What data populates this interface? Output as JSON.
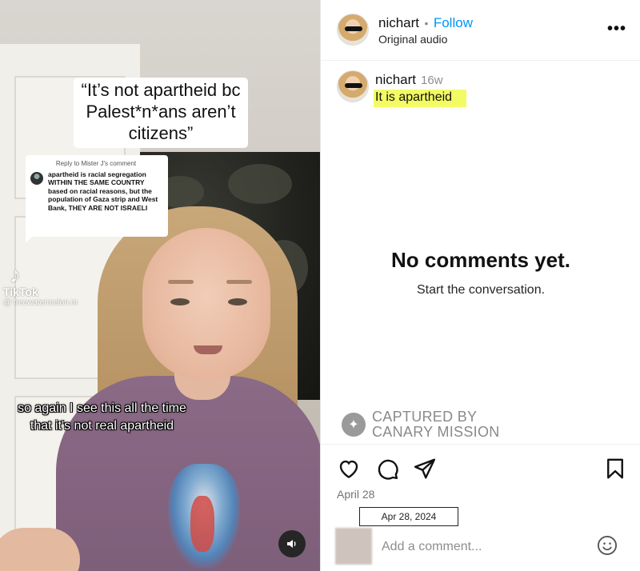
{
  "video": {
    "caption_overlay": "“It’s not apartheid bc Palest*n*ans aren’t citizens”",
    "reply_card": {
      "header": "Reply to Mister J's comment",
      "text": "apartheid is racial segregation WITHIN THE SAME COUNTRY based on racial reasons, but the population of Gaza strip and West Bank, THEY ARE NOT ISRAELI"
    },
    "tiktok": {
      "brand": "TikTok",
      "handle": "@ freewatermelon.m"
    },
    "subtitle": "so again I see this all the time that it's not real apartheid",
    "sound_icon": "speaker-icon"
  },
  "post_header": {
    "username": "nichart",
    "separator": "•",
    "follow_label": "Follow",
    "audio_label": "Original audio",
    "more_label": "•••"
  },
  "comment": {
    "username": "nichart",
    "age": "16w",
    "text": "It is apartheid",
    "highlight_color": "#f3fb64"
  },
  "empty_state": {
    "title": "No comments yet.",
    "subtitle": "Start the conversation."
  },
  "watermark": {
    "line1": "CAPTURED BY",
    "line2": "CANARY MISSION"
  },
  "actions": {
    "icons": [
      "heart-icon",
      "comment-icon",
      "share-icon",
      "bookmark-icon"
    ],
    "date": "April 28",
    "date_tooltip": "Apr 28, 2024"
  },
  "add_comment": {
    "placeholder": "Add a comment...",
    "emoji_icon": "smiley-icon"
  },
  "colors": {
    "follow_blue": "#0095f6",
    "highlight": "#f3fb64",
    "muted": "#8e8e8e"
  }
}
